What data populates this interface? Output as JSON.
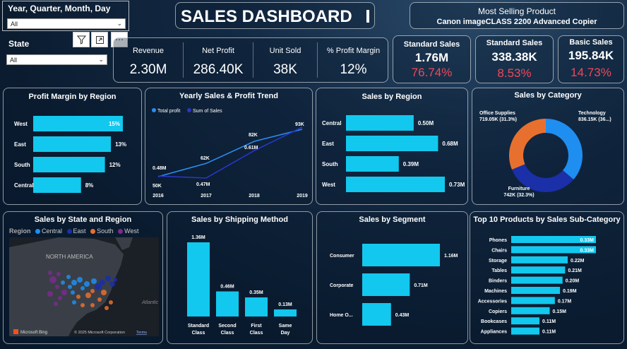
{
  "slicers": {
    "date": {
      "title": "Year, Quarter, Month, Day",
      "value": "All"
    },
    "state": {
      "title": "State",
      "value": "All"
    }
  },
  "header": {
    "title": "SALES DASHBOARD"
  },
  "most_selling": {
    "label": "Most Selling Product",
    "value": "Canon imageCLASS 2200 Advanced Copier"
  },
  "kpis": [
    {
      "label": "Revenue",
      "value": "2.30M"
    },
    {
      "label": "Net Profit",
      "value": "286.40K"
    },
    {
      "label": "Unit Sold",
      "value": "38K"
    },
    {
      "label": "% Profit Margin",
      "value": "12%"
    }
  ],
  "segment_cards": [
    {
      "label": "Standard Sales",
      "value": "1.76M",
      "pct": "76.74%"
    },
    {
      "label": "Standard Sales",
      "value": "338.38K",
      "pct": "8.53%"
    },
    {
      "label": "Basic Sales",
      "value": "195.84K",
      "pct": "14.73%"
    }
  ],
  "colors": {
    "bar": "#12c8ee",
    "accent_red": "#f0475a",
    "line1": "#2b8cf0",
    "line2": "#2a36c8"
  },
  "chart_data": [
    {
      "id": "profit_margin_region",
      "type": "bar",
      "orientation": "horizontal",
      "title": "Profit Margin by Region",
      "categories": [
        "West",
        "East",
        "South",
        "Central"
      ],
      "values": [
        15,
        13,
        12,
        8
      ],
      "labels": [
        "15%",
        "13%",
        "12%",
        "8%"
      ]
    },
    {
      "id": "yearly_trend",
      "type": "line",
      "title": "Yearly Sales & Profit Trend",
      "x": [
        "2016",
        "2017",
        "2018",
        "2019"
      ],
      "series": [
        {
          "name": "Total profit",
          "values": [
            50,
            62,
            82,
            93
          ],
          "labels": [
            "50K",
            "62K",
            "82K",
            "93K"
          ]
        },
        {
          "name": "Sum of Sales",
          "values": [
            0.48,
            0.47,
            0.61,
            0.73
          ],
          "labels": [
            "0.48M",
            "0.47M",
            "0.61M",
            ""
          ]
        }
      ]
    },
    {
      "id": "sales_region",
      "type": "bar",
      "orientation": "horizontal",
      "title": "Sales by Region",
      "categories": [
        "Central",
        "East",
        "South",
        "West"
      ],
      "values": [
        0.5,
        0.68,
        0.39,
        0.73
      ],
      "labels": [
        "0.50M",
        "0.68M",
        "0.39M",
        "0.73M"
      ]
    },
    {
      "id": "sales_category",
      "type": "pie",
      "variant": "donut",
      "title": "Sales by Category",
      "categories": [
        "Technology",
        "Furniture",
        "Office Supplies"
      ],
      "values": [
        836.15,
        742,
        719.05
      ],
      "labels": [
        "836.15K (36...)",
        "742K (32.3%)",
        "719.05K (31.3%)"
      ],
      "colors": [
        "#1f8ef1",
        "#1a2fa8",
        "#e8702f"
      ]
    },
    {
      "id": "sales_state_region",
      "type": "map",
      "title": "Sales by State and Region",
      "legend_title": "Region",
      "legend": [
        {
          "name": "Central",
          "color": "#1f8ef1"
        },
        {
          "name": "East",
          "color": "#1a2fa8"
        },
        {
          "name": "South",
          "color": "#e8702f"
        },
        {
          "name": "West",
          "color": "#7b2a8f"
        }
      ],
      "map_labels": {
        "region": "NORTH AMERICA",
        "ocean": "Atlantic",
        "brand": "Microsoft Bing",
        "copyright": "© 2025 Microsoft Corporation",
        "terms": "Terms"
      }
    },
    {
      "id": "sales_shipping",
      "type": "bar",
      "orientation": "vertical",
      "title": "Sales by Shipping Method",
      "categories": [
        "Standard Class",
        "Second Class",
        "First Class",
        "Same Day"
      ],
      "values": [
        1.36,
        0.46,
        0.35,
        0.13
      ],
      "labels": [
        "1.36M",
        "0.46M",
        "0.35M",
        "0.13M"
      ]
    },
    {
      "id": "sales_segment",
      "type": "bar",
      "orientation": "horizontal",
      "title": "Sales by Segment",
      "categories": [
        "Consumer",
        "Corporate",
        "Home O..."
      ],
      "values": [
        1.16,
        0.71,
        0.43
      ],
      "labels": [
        "1.16M",
        "0.71M",
        "0.43M"
      ]
    },
    {
      "id": "top10_subcat",
      "type": "bar",
      "orientation": "horizontal",
      "title": "Top 10 Products by Sales Sub-Category",
      "categories": [
        "Phones",
        "Chairs",
        "Storage",
        "Tables",
        "Binders",
        "Machines",
        "Accessories",
        "Copiers",
        "Bookcases",
        "Appliances"
      ],
      "values": [
        0.33,
        0.33,
        0.22,
        0.21,
        0.2,
        0.19,
        0.17,
        0.15,
        0.11,
        0.11
      ],
      "labels": [
        "0.33M",
        "0.33M",
        "0.22M",
        "0.21M",
        "0.20M",
        "0.19M",
        "0.17M",
        "0.15M",
        "0.11M",
        "0.11M"
      ]
    }
  ]
}
